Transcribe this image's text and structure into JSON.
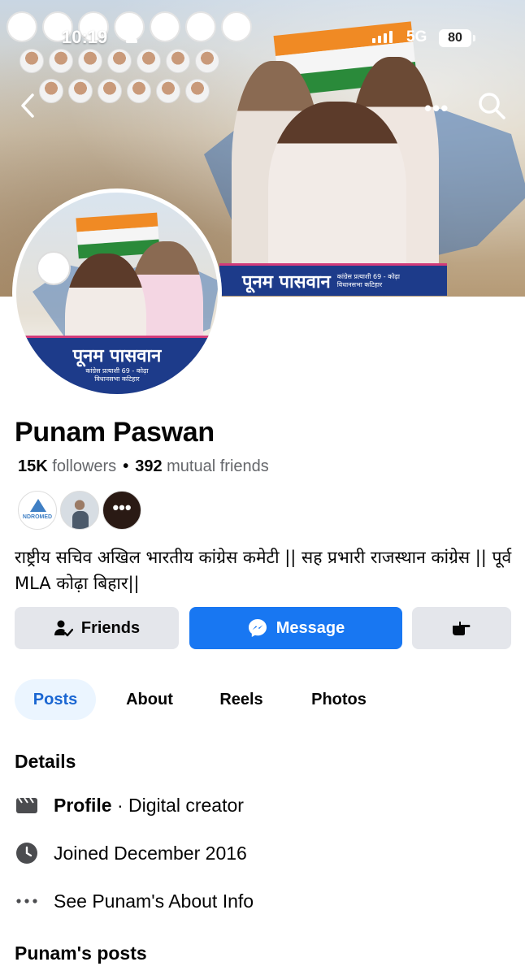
{
  "status_bar": {
    "time": "10:19",
    "network": "5G",
    "battery": "80"
  },
  "header": {
    "more_label": "•••"
  },
  "cover": {
    "banner_title": "पूनम पासवान",
    "banner_subtitle_1": "कांग्रेस प्रत्याशी 69 - कोढ़ा",
    "banner_subtitle_2": "विधानसभा कटिहार"
  },
  "avatar": {
    "banner_title": "पूनम पासवान",
    "banner_subtitle_1": "कांग्रेस प्रत्याशी 69 - कोढ़ा",
    "banner_subtitle_2": "विधानसभा कटिहार"
  },
  "profile": {
    "name": "Punam Paswan",
    "followers_count": "15K",
    "followers_label": "followers",
    "mutual_count": "392",
    "mutual_label": "mutual friends",
    "mutual_avatar_1_text": "NDROMED",
    "mutual_more": "•••",
    "bio": "राष्ट्रीय सचिव अखिल भारतीय कांग्रेस कमेटी || सह प्रभारी राजस्थान कांग्रेस || पूर्व MLA कोढ़ा बिहार||"
  },
  "actions": {
    "friends": "Friends",
    "message": "Message"
  },
  "tabs": [
    "Posts",
    "About",
    "Reels",
    "Photos"
  ],
  "details": {
    "title": "Details",
    "profile_bold": "Profile",
    "profile_rest": " · Digital creator",
    "joined": "Joined December 2016",
    "about_info": "See Punam's About Info"
  },
  "posts_title": "Punam's posts",
  "colors": {
    "accent": "#1877f2",
    "tab_active_bg": "#ebf5ff",
    "button_gray": "#e4e6eb",
    "banner_blue": "#1d3b8a"
  }
}
